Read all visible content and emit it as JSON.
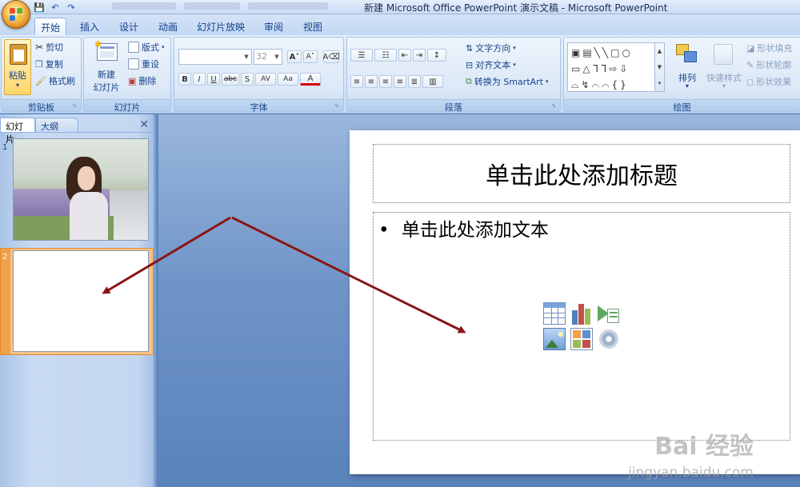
{
  "window": {
    "title": "新建 Microsoft Office PowerPoint 演示文稿 - Microsoft PowerPoint"
  },
  "tabs": [
    {
      "label": "开始",
      "active": true
    },
    {
      "label": "插入"
    },
    {
      "label": "设计"
    },
    {
      "label": "动画"
    },
    {
      "label": "幻灯片放映"
    },
    {
      "label": "审阅"
    },
    {
      "label": "视图"
    }
  ],
  "ribbon": {
    "clipboard": {
      "paste": "粘贴",
      "cut": "剪切",
      "copy": "复制",
      "format_painter": "格式刷",
      "label": "剪贴板"
    },
    "slides": {
      "new_slide_line1": "新建",
      "new_slide_line2": "幻灯片",
      "layout": "版式",
      "reset": "重设",
      "delete": "删除",
      "label": "幻灯片"
    },
    "font": {
      "font_name": "",
      "font_size": "32",
      "label": "字体",
      "bold": "B",
      "italic": "I",
      "underline": "U",
      "strike": "abc",
      "shadow": "S",
      "spacing": "AV",
      "case": "Aa",
      "color": "A"
    },
    "paragraph": {
      "text_direction": "文字方向",
      "align_text": "对齐文本",
      "smartart": "转换为 SmartArt",
      "label": "段落"
    },
    "drawing": {
      "arrange": "排列",
      "quick_styles": "快速样式",
      "shape_fill": "形状填充",
      "shape_outline": "形状轮廓",
      "shape_effects": "形状效果",
      "label": "绘图"
    }
  },
  "pane": {
    "tab_slides": "幻灯片",
    "tab_outline": "大纲",
    "slide1_num": "1",
    "slide2_num": "2"
  },
  "slide": {
    "title_placeholder": "单击此处添加标题",
    "body_placeholder": "单击此处添加文本",
    "bullet": "•"
  },
  "watermark": {
    "main": "Bai 经验",
    "sub": "jingyan.baidu.com"
  },
  "colors": {
    "arrow": "#8b1414",
    "selected_thumb": "#f3c28a",
    "workspace": "#6f95c8"
  }
}
